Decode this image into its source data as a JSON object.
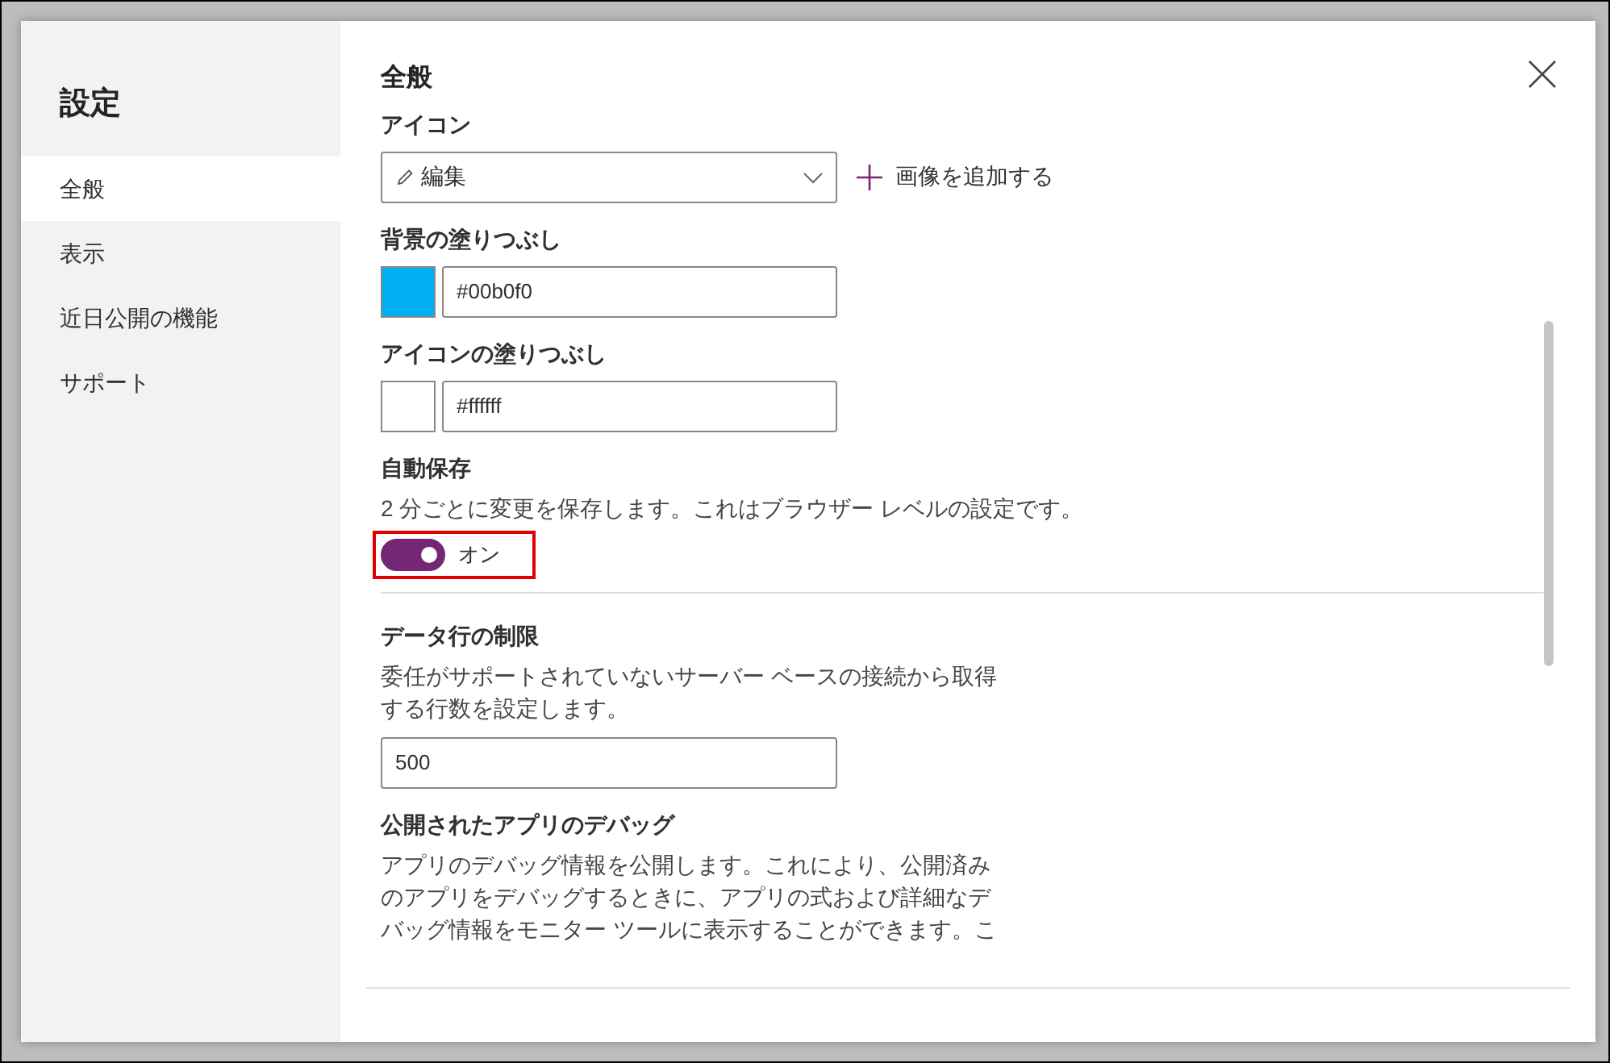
{
  "sidebar": {
    "title": "設定",
    "items": [
      {
        "label": "全般",
        "selected": true
      },
      {
        "label": "表示",
        "selected": false
      },
      {
        "label": "近日公開の機能",
        "selected": false
      },
      {
        "label": "サポート",
        "selected": false
      }
    ]
  },
  "section_title": "全般",
  "settings": [
    {
      "kind": "dropdown",
      "label": "アイコン",
      "value": "編集",
      "add_link": "画像を追加する"
    },
    {
      "kind": "color",
      "label": "背景の塗りつぶし",
      "color": "#00b0f0",
      "value": "#00b0f0"
    },
    {
      "kind": "color",
      "label": "アイコンの塗りつぶし",
      "color": "#ffffff",
      "value": "#ffffff"
    },
    {
      "kind": "toggle",
      "label": "自動保存",
      "description": [
        "2 分ごとに変更を保存します。これはブラウザー レベルの設定です。"
      ],
      "on": true,
      "state_label": "オン",
      "highlighted": true
    },
    {
      "kind": "number",
      "label": "データ行の制限",
      "description": [
        "委任がサポートされていないサーバー ベースの接続から取得",
        "する行数を設定します。"
      ],
      "value": "500"
    },
    {
      "kind": "text",
      "label": "公開されたアプリのデバッグ",
      "description": [
        "アプリのデバッグ情報を公開します。これにより、公開済み",
        "のアプリをデバッグするときに、アプリの式および詳細なデ",
        "バッグ情報をモニター ツールに表示することができます。こ"
      ]
    }
  ]
}
